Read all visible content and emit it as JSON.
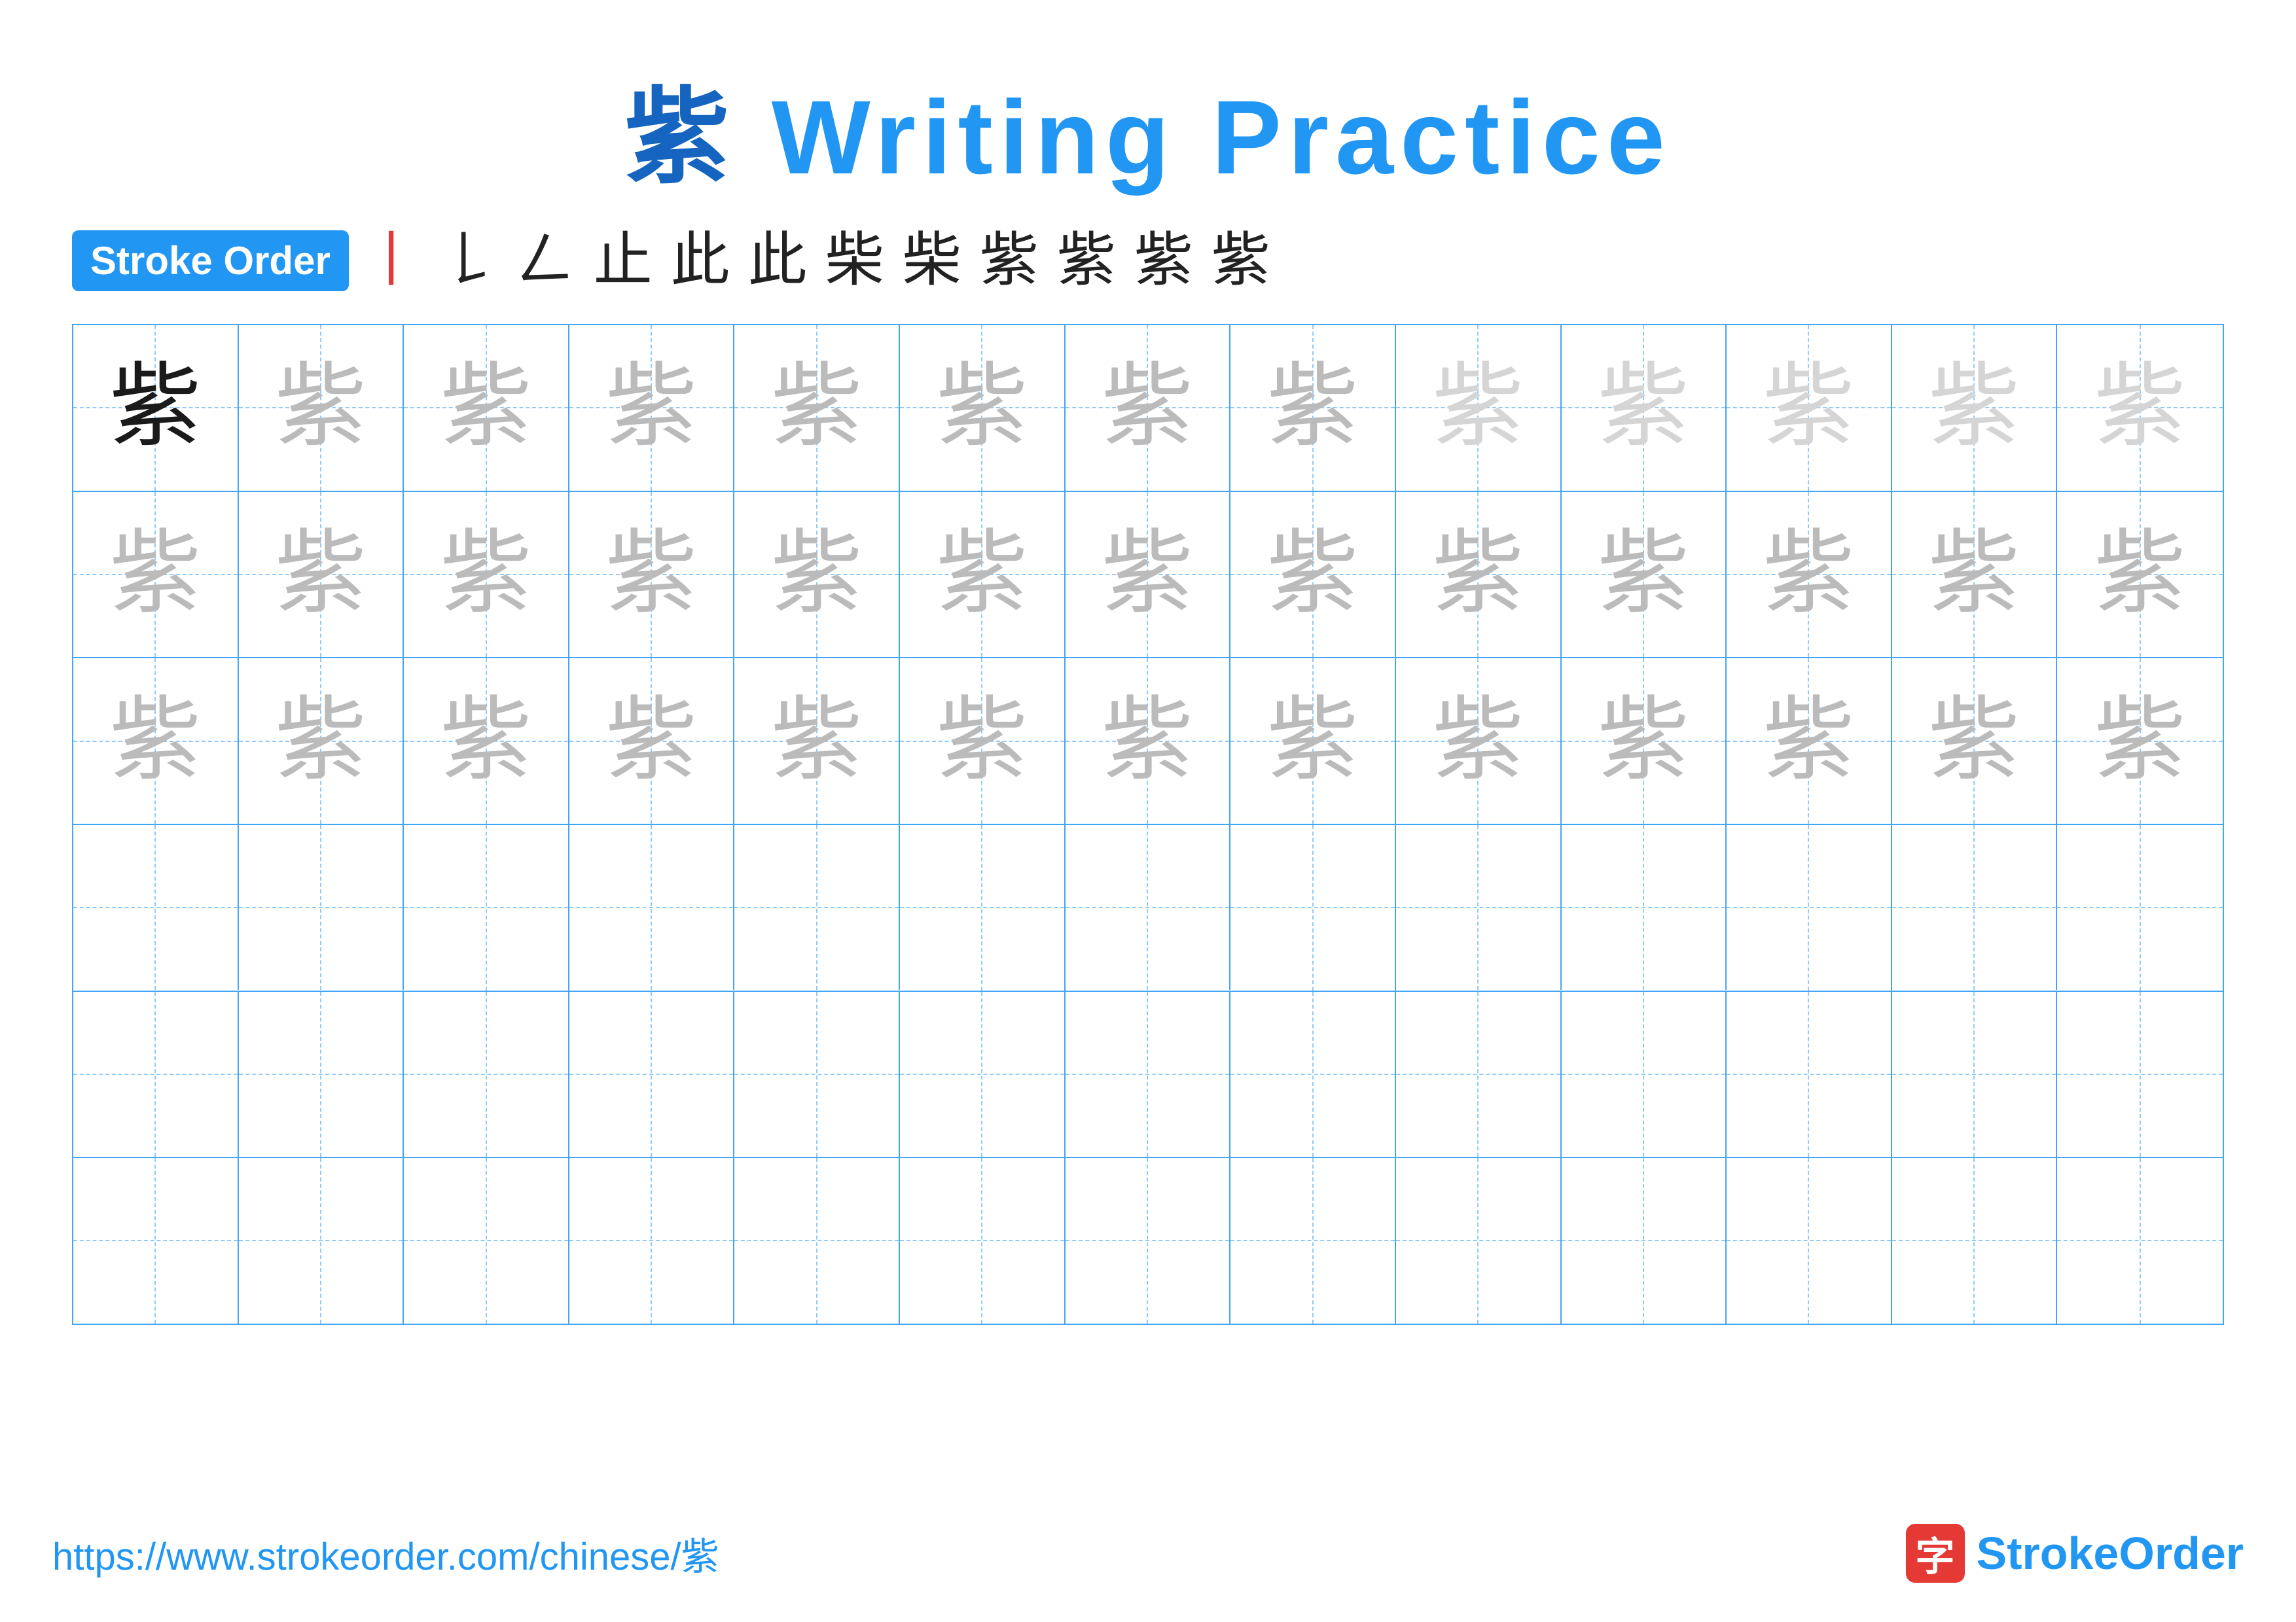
{
  "title": {
    "prefix_char": "紫",
    "suffix": " Writing Practice"
  },
  "stroke_order": {
    "badge_label": "Stroke Order",
    "strokes": [
      "丨",
      "𠃌",
      "𠃋",
      "止",
      "此",
      "此",
      "柴",
      "柴",
      "紫",
      "紫",
      "紫",
      "紫"
    ]
  },
  "character": "紫",
  "grid": {
    "rows": 6,
    "cols": 13,
    "row_data": [
      {
        "type": "mixed",
        "cells": [
          "dark",
          "medium",
          "medium",
          "medium",
          "medium",
          "medium",
          "medium",
          "medium",
          "light",
          "light",
          "light",
          "light",
          "light"
        ]
      },
      {
        "type": "mixed",
        "cells": [
          "medium",
          "medium",
          "medium",
          "medium",
          "medium",
          "medium",
          "medium",
          "medium",
          "medium",
          "medium",
          "medium",
          "medium",
          "medium"
        ]
      },
      {
        "type": "mixed",
        "cells": [
          "medium",
          "medium",
          "medium",
          "medium",
          "medium",
          "medium",
          "medium",
          "medium",
          "medium",
          "medium",
          "medium",
          "medium",
          "medium"
        ]
      },
      {
        "type": "empty",
        "cells": [
          "empty",
          "empty",
          "empty",
          "empty",
          "empty",
          "empty",
          "empty",
          "empty",
          "empty",
          "empty",
          "empty",
          "empty",
          "empty"
        ]
      },
      {
        "type": "empty",
        "cells": [
          "empty",
          "empty",
          "empty",
          "empty",
          "empty",
          "empty",
          "empty",
          "empty",
          "empty",
          "empty",
          "empty",
          "empty",
          "empty"
        ]
      },
      {
        "type": "empty",
        "cells": [
          "empty",
          "empty",
          "empty",
          "empty",
          "empty",
          "empty",
          "empty",
          "empty",
          "empty",
          "empty",
          "empty",
          "empty",
          "empty"
        ]
      }
    ]
  },
  "footer": {
    "url": "https://www.strokeorder.com/chinese/紫",
    "logo_char": "字",
    "logo_text_prefix": "Stroke",
    "logo_text_suffix": "Order"
  }
}
